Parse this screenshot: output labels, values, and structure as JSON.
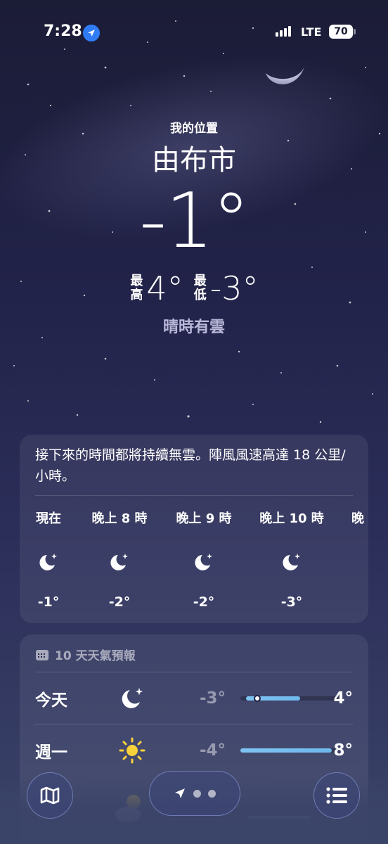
{
  "status_bar": {
    "time": "7:28",
    "network": "LTE",
    "battery": "70"
  },
  "hero": {
    "my_location": "我的位置",
    "city": "由布市",
    "temperature": "-1°",
    "high_label": "最高",
    "high": "4°",
    "low_label": "最低",
    "low": "-3°",
    "condition": "晴時有雲"
  },
  "hourly": {
    "summary": "接下來的時間都將持續無雲。陣風風速高達 18 公里/小時。",
    "items": [
      {
        "label": "現在",
        "icon": "moon-stars-icon",
        "temp": "-1°"
      },
      {
        "label": "晚上 8 時",
        "icon": "moon-stars-icon",
        "temp": "-2°"
      },
      {
        "label": "晚上 9 時",
        "icon": "moon-stars-icon",
        "temp": "-2°"
      },
      {
        "label": "晚上 10 時",
        "icon": "moon-stars-icon",
        "temp": "-3°"
      },
      {
        "label": "晚",
        "icon": "",
        "temp": ""
      }
    ]
  },
  "forecast": {
    "header": "10 天天氣預報",
    "days": [
      {
        "day": "今天",
        "icon": "moon-stars-icon",
        "low": "-3°",
        "high": "4°",
        "range_start": 0.06,
        "range_end": 0.61,
        "current": 0.17
      },
      {
        "day": "週一",
        "icon": "sun-icon",
        "low": "-4°",
        "high": "8°",
        "range_start": 0.0,
        "range_end": 0.93
      }
    ]
  },
  "colors": {
    "background_top": "#1b1c36",
    "background_bottom": "#3a4368",
    "location_accent": "#2f7cf6",
    "range_bar": "#7ec4f2",
    "condition_text": "#b9b8d9"
  }
}
